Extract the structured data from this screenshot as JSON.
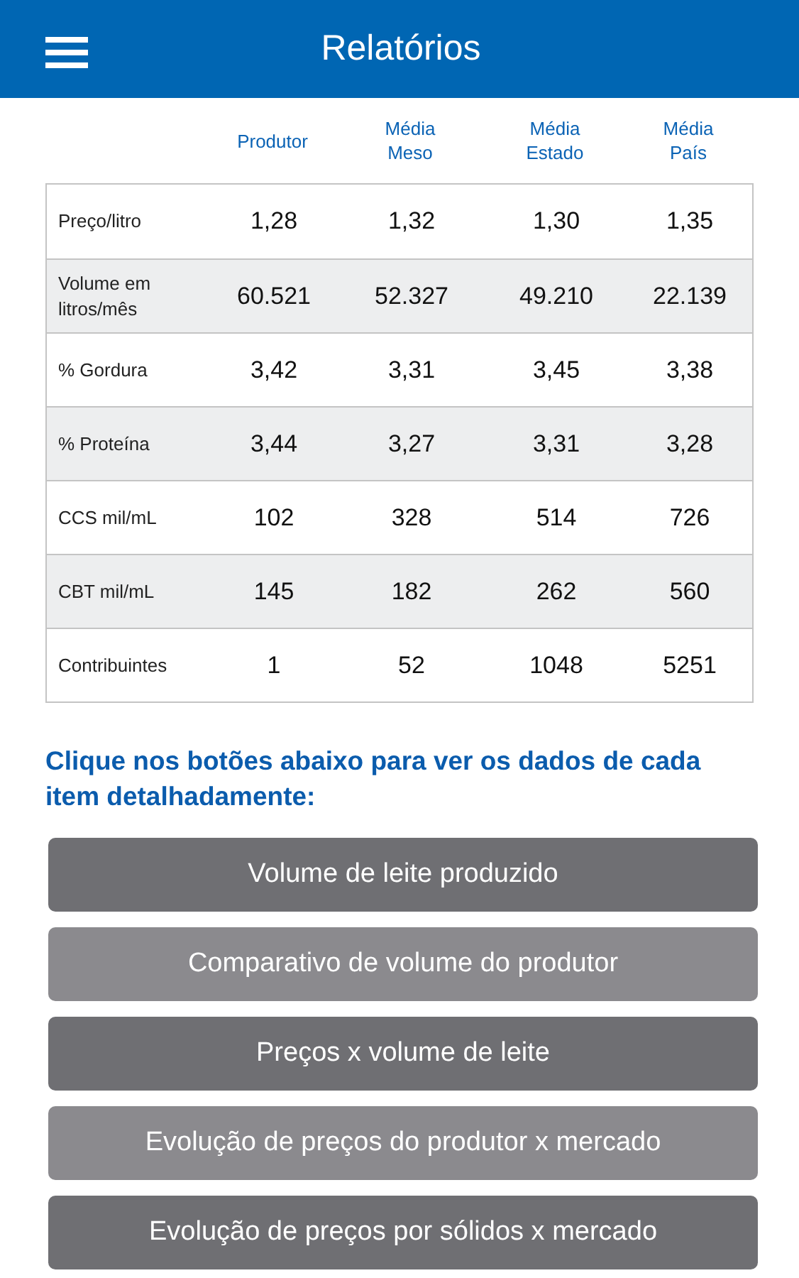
{
  "header": {
    "title": "Relatórios"
  },
  "table": {
    "columns": [
      "Produtor",
      "Média\nMeso",
      "Média\nEstado",
      "Média\nPaís"
    ],
    "rows": [
      {
        "label": "Preço/litro",
        "values": [
          "1,28",
          "1,32",
          "1,30",
          "1,35"
        ]
      },
      {
        "label": "Volume em\nlitros/mês",
        "values": [
          "60.521",
          "52.327",
          "49.210",
          "22.139"
        ]
      },
      {
        "label": "% Gordura",
        "values": [
          "3,42",
          "3,31",
          "3,45",
          "3,38"
        ]
      },
      {
        "label": "% Proteína",
        "values": [
          "3,44",
          "3,27",
          "3,31",
          "3,28"
        ]
      },
      {
        "label": "CCS mil/mL",
        "values": [
          "102",
          "328",
          "514",
          "726"
        ]
      },
      {
        "label": "CBT  mil/mL",
        "values": [
          "145",
          "182",
          "262",
          "560"
        ]
      },
      {
        "label": "Contribuintes",
        "values": [
          "1",
          "52",
          "1048",
          "5251"
        ]
      }
    ]
  },
  "intro": "Clique nos botões abaixo para ver os dados de cada item detalhadamente:",
  "buttons": [
    {
      "label": "Volume de leite produzido",
      "kind": "dark"
    },
    {
      "label": "Comparativo de volume do produtor",
      "kind": "light"
    },
    {
      "label": "Preços x volume de leite",
      "kind": "dark"
    },
    {
      "label": "Evolução de preços do produtor x mercado",
      "kind": "light"
    },
    {
      "label": "Evolução de preços por sólidos x mercado",
      "kind": "dark"
    }
  ]
}
